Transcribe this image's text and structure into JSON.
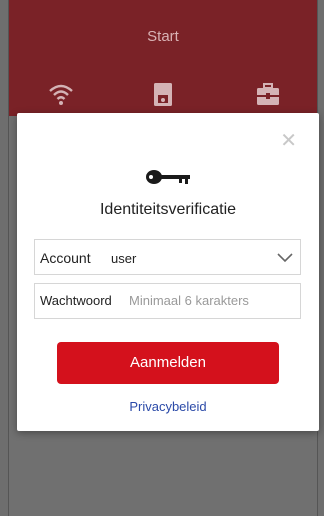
{
  "topbar": {
    "title": "Start",
    "icons": [
      "wifi-icon",
      "device-icon",
      "toolbox-icon"
    ]
  },
  "dialog": {
    "close_icon": "close-icon",
    "key_icon": "key-icon",
    "title": "Identiteitsverificatie",
    "account": {
      "label": "Account",
      "value": "user"
    },
    "password": {
      "label": "Wachtwoord",
      "placeholder": "Minimaal 6 karakters"
    },
    "login_label": "Aanmelden",
    "privacy_label": "Privacybeleid"
  },
  "colors": {
    "header": "#7a2227",
    "accent": "#d4111c",
    "link": "#2b4aa8",
    "overlay": "#707070"
  }
}
